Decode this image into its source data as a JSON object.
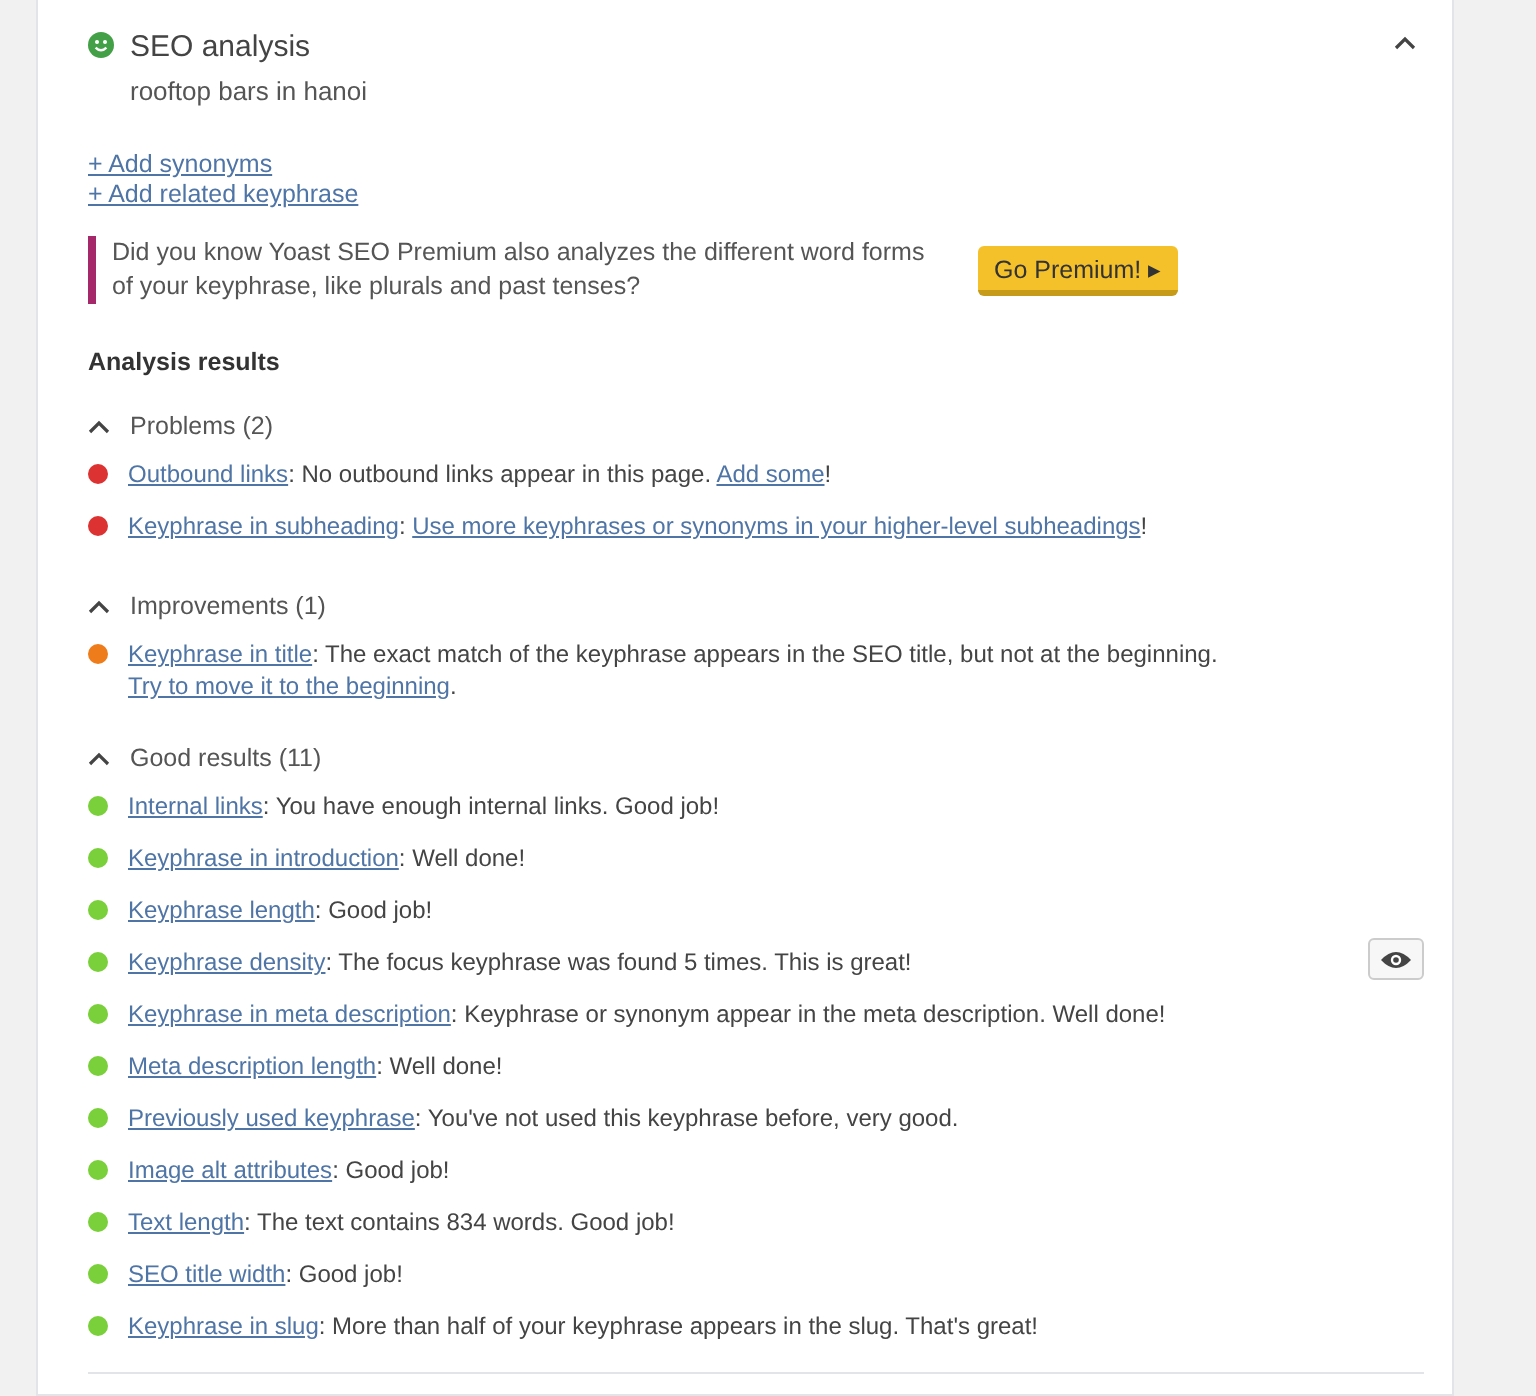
{
  "header": {
    "title": "SEO analysis",
    "keyphrase": "rooftop bars in hanoi",
    "expanded": true
  },
  "links": [
    "+ Add synonyms",
    "+ Add related keyphrase"
  ],
  "premium": {
    "text": "Did you know Yoast SEO Premium also analyzes the different word forms of your keyphrase, like plurals and past tenses?",
    "button": "Go Premium! ▸"
  },
  "results_title": "Analysis results",
  "sections": [
    {
      "title": "Problems (2)",
      "expanded": true,
      "items": [
        {
          "color": "#dc3232",
          "eye_button": false,
          "parts": [
            {
              "text": "Outbound links",
              "link": true
            },
            {
              "text": ": No outbound links appear in this page. ",
              "link": false
            },
            {
              "text": "Add some",
              "link": true
            },
            {
              "text": "!",
              "link": false
            }
          ]
        },
        {
          "color": "#dc3232",
          "eye_button": false,
          "parts": [
            {
              "text": "Keyphrase in subheading",
              "link": true
            },
            {
              "text": ": ",
              "link": false
            },
            {
              "text": "Use more keyphrases or synonyms in your higher-level subheadings",
              "link": true
            },
            {
              "text": "!",
              "link": false
            }
          ]
        }
      ]
    },
    {
      "title": "Improvements (1)",
      "expanded": true,
      "items": [
        {
          "color": "#ee7c1b",
          "eye_button": false,
          "parts": [
            {
              "text": "Keyphrase in title",
              "link": true
            },
            {
              "text": ": The exact match of the keyphrase appears in the SEO title, but not at the beginning. ",
              "link": false
            },
            {
              "text": "Try to move it to the beginning",
              "link": true
            },
            {
              "text": ".",
              "link": false
            }
          ]
        }
      ]
    },
    {
      "title": "Good results (11)",
      "expanded": true,
      "items": [
        {
          "color": "#7ad03a",
          "eye_button": false,
          "parts": [
            {
              "text": "Internal links",
              "link": true
            },
            {
              "text": ": You have enough internal links. Good job!",
              "link": false
            }
          ]
        },
        {
          "color": "#7ad03a",
          "eye_button": false,
          "parts": [
            {
              "text": "Keyphrase in introduction",
              "link": true
            },
            {
              "text": ": Well done!",
              "link": false
            }
          ]
        },
        {
          "color": "#7ad03a",
          "eye_button": false,
          "parts": [
            {
              "text": "Keyphrase length",
              "link": true
            },
            {
              "text": ": Good job!",
              "link": false
            }
          ]
        },
        {
          "color": "#7ad03a",
          "eye_button": true,
          "parts": [
            {
              "text": "Keyphrase density",
              "link": true
            },
            {
              "text": ": The focus keyphrase was found 5 times. This is great!",
              "link": false
            }
          ]
        },
        {
          "color": "#7ad03a",
          "eye_button": false,
          "parts": [
            {
              "text": "Keyphrase in meta description",
              "link": true
            },
            {
              "text": ": Keyphrase or synonym appear in the meta description. Well done!",
              "link": false
            }
          ]
        },
        {
          "color": "#7ad03a",
          "eye_button": false,
          "parts": [
            {
              "text": "Meta description length",
              "link": true
            },
            {
              "text": ": Well done!",
              "link": false
            }
          ]
        },
        {
          "color": "#7ad03a",
          "eye_button": false,
          "parts": [
            {
              "text": "Previously used keyphrase",
              "link": true
            },
            {
              "text": ": You've not used this keyphrase before, very good.",
              "link": false
            }
          ]
        },
        {
          "color": "#7ad03a",
          "eye_button": false,
          "parts": [
            {
              "text": "Image alt attributes",
              "link": true
            },
            {
              "text": ": Good job!",
              "link": false
            }
          ]
        },
        {
          "color": "#7ad03a",
          "eye_button": false,
          "parts": [
            {
              "text": "Text length",
              "link": true
            },
            {
              "text": ": The text contains 834 words. Good job!",
              "link": false
            }
          ]
        },
        {
          "color": "#7ad03a",
          "eye_button": false,
          "parts": [
            {
              "text": "SEO title width",
              "link": true
            },
            {
              "text": ": Good job!",
              "link": false
            }
          ]
        },
        {
          "color": "#7ad03a",
          "eye_button": false,
          "parts": [
            {
              "text": "Keyphrase in slug",
              "link": true
            },
            {
              "text": ": More than half of your keyphrase appears in the slug. That's great!",
              "link": false
            }
          ]
        }
      ]
    }
  ]
}
